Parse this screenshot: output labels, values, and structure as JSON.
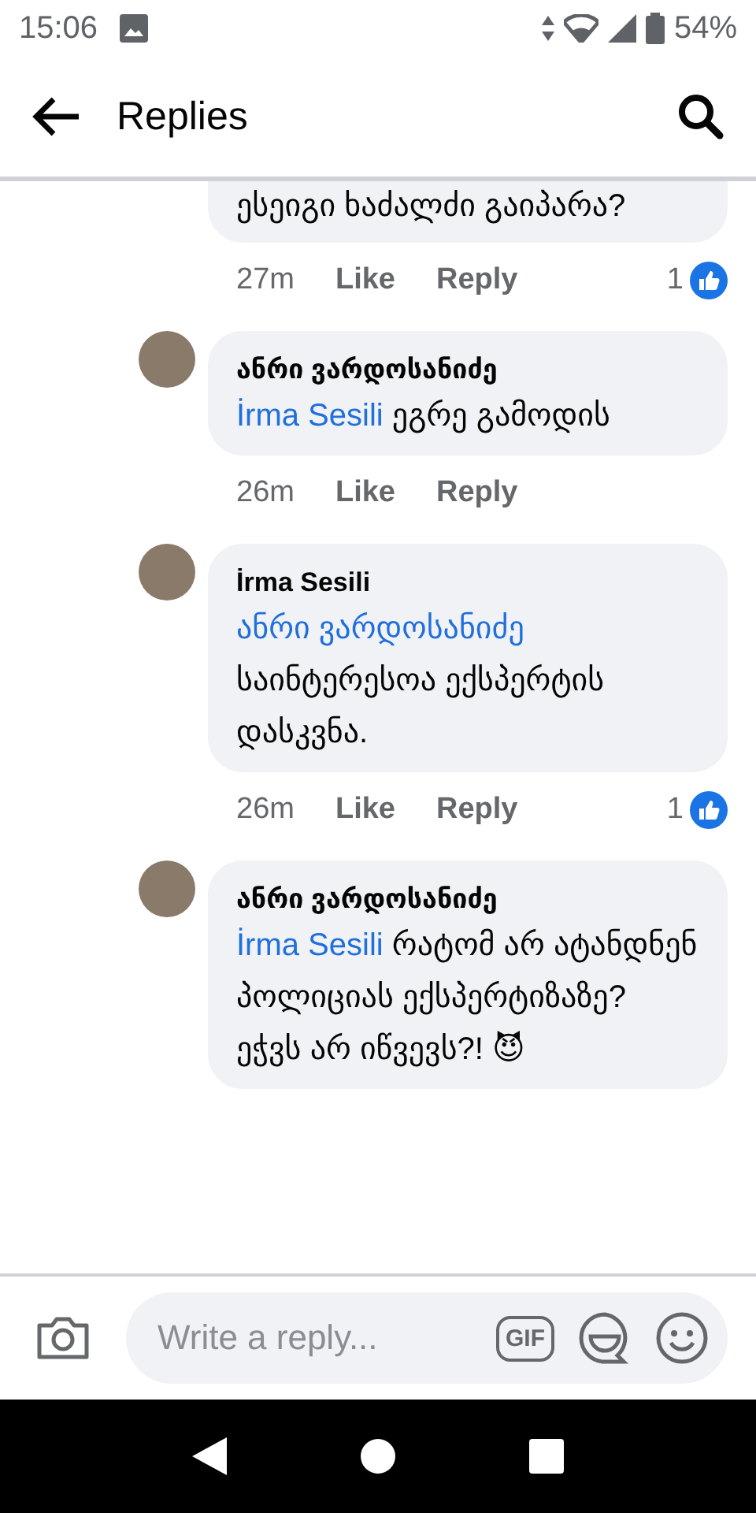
{
  "status_bar": {
    "time": "15:06",
    "battery": "54%"
  },
  "header": {
    "title": "Replies"
  },
  "comments": [
    {
      "kind": "partial",
      "text": "ესეიგი ხაძალძი გაიპარა?",
      "time": "27m",
      "like": "Like",
      "reply": "Reply",
      "reactions": "1"
    },
    {
      "kind": "full",
      "author": "ანრი ვარდოსანიძე",
      "mention": "İrma Sesili",
      "text": "ეგრე გამოდის",
      "time": "26m",
      "like": "Like",
      "reply": "Reply"
    },
    {
      "kind": "full",
      "author": "İrma Sesili",
      "mention": "ანრი ვარდოსანიძე",
      "text": "საინტერესოა ექსპერტის დასკვნა.",
      "time": "26m",
      "like": "Like",
      "reply": "Reply",
      "reactions": "1"
    },
    {
      "kind": "full",
      "author": "ანრი ვარდოსანიძე",
      "mention": "İrma Sesili",
      "text": "რატომ არ ატანდნენ პოლიციას ექსპერტიზაზე? ეჭვს არ იწვევს?! 😈"
    }
  ],
  "composer": {
    "placeholder": "Write a reply...",
    "gif": "GIF"
  }
}
